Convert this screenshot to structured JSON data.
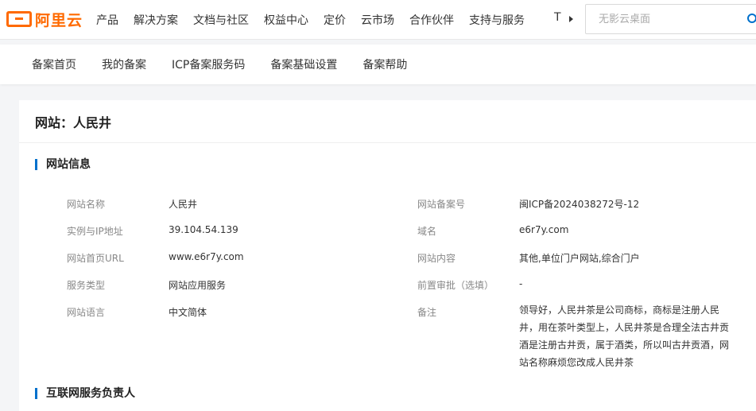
{
  "brand": {
    "logo_text": "阿里云",
    "accent": "#ff6a00",
    "link_color": "#0070cc"
  },
  "topnav": {
    "items": [
      "产品",
      "解决方案",
      "文档与社区",
      "权益中心",
      "定价",
      "云市场",
      "合作伙伴",
      "支持与服务"
    ],
    "more_glyph": "T",
    "search_placeholder": "无影云桌面"
  },
  "subnav": {
    "items": [
      "备案首页",
      "我的备案",
      "ICP备案服务码",
      "备案基础设置",
      "备案帮助"
    ]
  },
  "page": {
    "title": "网站：人民井",
    "section_site_info": "网站信息",
    "section_responsible": "互联网服务负责人"
  },
  "site_info": {
    "left": [
      {
        "label": "网站名称",
        "value": "人民井"
      },
      {
        "label": "实例与IP地址",
        "value": "39.104.54.139"
      },
      {
        "label": "网站首页URL",
        "value": "www.e6r7y.com"
      },
      {
        "label": "服务类型",
        "value": "网站应用服务"
      },
      {
        "label": "网站语言",
        "value": "中文简体"
      }
    ],
    "right": [
      {
        "label": "网站备案号",
        "value": "闽ICP备2024038272号-12"
      },
      {
        "label": "域名",
        "value": "e6r7y.com"
      },
      {
        "label": "网站内容",
        "value": "其他,单位门户网站,综合门户"
      },
      {
        "label": "前置审批（选填）",
        "value": "-"
      },
      {
        "label": "备注",
        "value": "领导好，人民井茶是公司商标，商标是注册人民井，用在茶叶类型上，人民井茶是合理全法古井贡酒是注册古井贡，属于酒类，所以叫古井贡酒，网站名称麻烦您改成人民井茶"
      }
    ]
  }
}
